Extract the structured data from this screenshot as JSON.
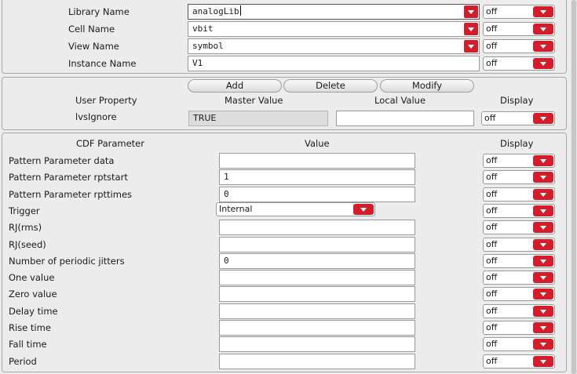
{
  "top_fields": [
    {
      "label": "Library Name",
      "value": "analogLib",
      "type": "combo",
      "focused": true,
      "display": "off"
    },
    {
      "label": "Cell Name",
      "value": "vbit",
      "type": "combo",
      "display": "off"
    },
    {
      "label": "View Name",
      "value": "symbol",
      "type": "combo",
      "display": "off"
    },
    {
      "label": "Instance Name",
      "value": "V1",
      "type": "text",
      "display": "off"
    }
  ],
  "property_section": {
    "buttons": {
      "add": "Add",
      "delete": "Delete",
      "modify": "Modify"
    },
    "headers": {
      "property": "User Property",
      "master": "Master Value",
      "local": "Local Value",
      "display": "Display"
    },
    "rows": [
      {
        "name": "lvsIgnore",
        "master": "TRUE",
        "local": "",
        "display": "off"
      }
    ]
  },
  "cdf_section": {
    "headers": {
      "parameter": "CDF Parameter",
      "value": "Value",
      "display": "Display"
    },
    "rows": [
      {
        "label": "Pattern Parameter data",
        "value": "",
        "kind": "text",
        "display": "off"
      },
      {
        "label": "Pattern Parameter rptstart",
        "value": "1",
        "kind": "text",
        "display": "off"
      },
      {
        "label": "Pattern Parameter rpttimes",
        "value": "0",
        "kind": "text",
        "display": "off"
      },
      {
        "label": "Trigger",
        "value": "Internal",
        "kind": "select",
        "display": "off"
      },
      {
        "label": "RJ(rms)",
        "value": "",
        "kind": "text",
        "display": "off"
      },
      {
        "label": "RJ(seed)",
        "value": "",
        "kind": "text",
        "display": "off"
      },
      {
        "label": "Number of periodic jitters",
        "value": "0",
        "kind": "text",
        "display": "off"
      },
      {
        "label": "One value",
        "value": "",
        "kind": "text",
        "display": "off"
      },
      {
        "label": "Zero value",
        "value": "",
        "kind": "text",
        "display": "off"
      },
      {
        "label": "Delay time",
        "value": "",
        "kind": "text",
        "display": "off"
      },
      {
        "label": "Rise time",
        "value": "",
        "kind": "text",
        "display": "off"
      },
      {
        "label": "Fall time",
        "value": "",
        "kind": "text",
        "display": "off"
      },
      {
        "label": "Period",
        "value": "",
        "kind": "text",
        "display": "off"
      }
    ]
  },
  "colors": {
    "dropdown_arrow": "#d31d2a",
    "panel_bg": "#ececec",
    "field_bg": "#ffffff"
  }
}
